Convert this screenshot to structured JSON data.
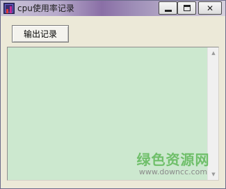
{
  "window": {
    "title": "cpu使用率记录",
    "controls": {
      "minimize": "minimize-icon",
      "maximize": "maximize-icon",
      "close": "close-icon"
    }
  },
  "toolbar": {
    "export_label": "输出记录"
  },
  "log": {
    "value": "",
    "background": "#cce8cf",
    "scroll_up": "▲",
    "scroll_down": "▼"
  },
  "watermark": {
    "name": "绿色资源网",
    "url": "www.downcc.com"
  }
}
